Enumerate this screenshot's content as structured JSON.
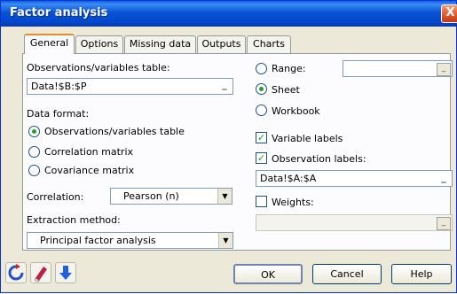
{
  "window": {
    "title": "Factor analysis",
    "close_glyph": "X"
  },
  "tabs": [
    {
      "label": "General",
      "active": true
    },
    {
      "label": "Options"
    },
    {
      "label": "Missing data"
    },
    {
      "label": "Outputs"
    },
    {
      "label": "Charts"
    }
  ],
  "left": {
    "obs_table_label": "Observations/variables table:",
    "obs_table_value": "Data!$B:$P",
    "data_format_label": "Data format:",
    "data_format_options": [
      {
        "label": "Observations/variables table",
        "selected": true
      },
      {
        "label": "Correlation matrix",
        "selected": false
      },
      {
        "label": "Covariance matrix",
        "selected": false
      }
    ],
    "correlation_label": "Correlation:",
    "correlation_value": "Pearson (n)",
    "extraction_label": "Extraction method:",
    "extraction_value": "Principal factor analysis"
  },
  "right": {
    "range_label": "Range:",
    "range_value": "",
    "sheet_label": "Sheet",
    "workbook_label": "Workbook",
    "selected_output": "Sheet",
    "variable_labels_label": "Variable labels",
    "variable_labels_checked": true,
    "observation_labels_label": "Observation labels:",
    "observation_labels_checked": true,
    "observation_labels_value": "Data!$A:$A",
    "weights_label": "Weights:",
    "weights_checked": false,
    "weights_value": ""
  },
  "buttons": {
    "ok": "OK",
    "cancel": "Cancel",
    "help": "Help"
  },
  "icons": {
    "reset": "reset-icon",
    "clear": "eraser-icon",
    "down": "down-arrow-icon"
  },
  "colors": {
    "titlebar": "#0853d6",
    "dialog_bg": "#ece9d8",
    "active_tab_accent": "#e68b2c",
    "selected_mark": "#21a121"
  }
}
